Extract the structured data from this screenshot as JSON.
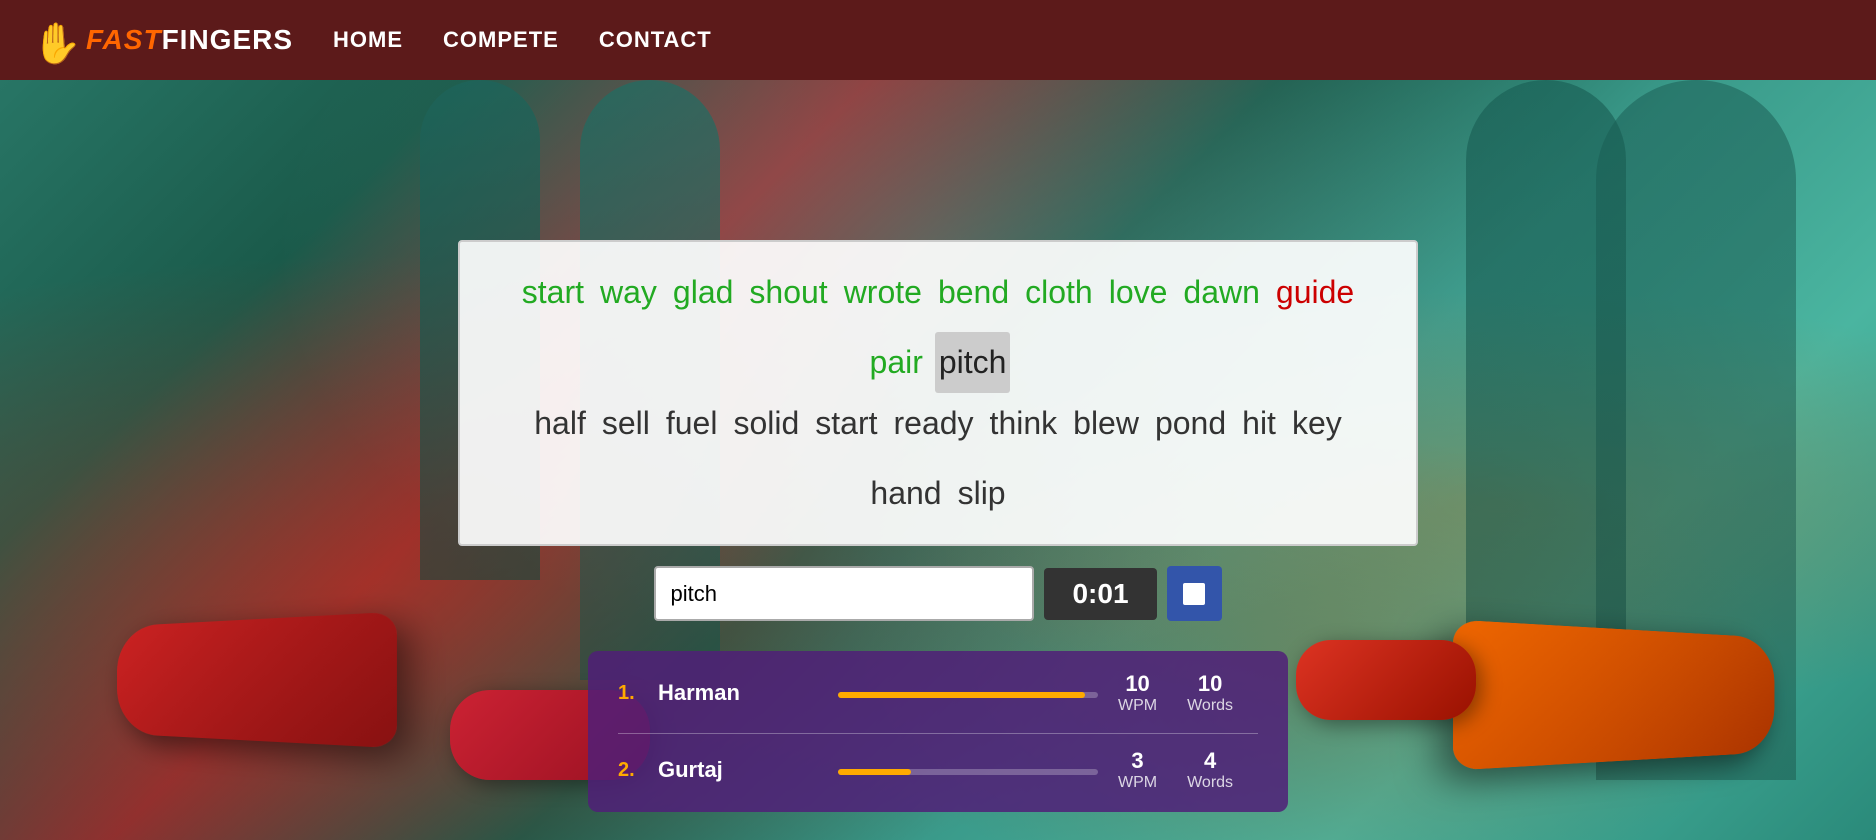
{
  "nav": {
    "logo_fast": "FAST",
    "logo_fingers": "FINGERS",
    "links": [
      {
        "label": "HOME",
        "id": "home"
      },
      {
        "label": "COMPETE",
        "id": "compete"
      },
      {
        "label": "CONTACT",
        "id": "contact"
      }
    ]
  },
  "words": {
    "row1": [
      {
        "text": "start",
        "state": "typed-correct"
      },
      {
        "text": "way",
        "state": "typed-correct"
      },
      {
        "text": "glad",
        "state": "typed-correct"
      },
      {
        "text": "shout",
        "state": "typed-correct"
      },
      {
        "text": "wrote",
        "state": "typed-correct"
      },
      {
        "text": "bend",
        "state": "typed-correct"
      },
      {
        "text": "cloth",
        "state": "typed-correct"
      },
      {
        "text": "love",
        "state": "typed-correct"
      },
      {
        "text": "dawn",
        "state": "typed-correct"
      },
      {
        "text": "guide",
        "state": "typed-error"
      },
      {
        "text": "pair",
        "state": "typed-correct"
      },
      {
        "text": "pitch",
        "state": "current"
      }
    ],
    "row2": [
      {
        "text": "half",
        "state": "upcoming"
      },
      {
        "text": "sell",
        "state": "upcoming"
      },
      {
        "text": "fuel",
        "state": "upcoming"
      },
      {
        "text": "solid",
        "state": "upcoming"
      },
      {
        "text": "start",
        "state": "upcoming"
      },
      {
        "text": "ready",
        "state": "upcoming"
      },
      {
        "text": "think",
        "state": "upcoming"
      },
      {
        "text": "blew",
        "state": "upcoming"
      },
      {
        "text": "pond",
        "state": "upcoming"
      },
      {
        "text": "hit",
        "state": "upcoming"
      },
      {
        "text": "key",
        "state": "upcoming"
      },
      {
        "text": "hand",
        "state": "upcoming"
      },
      {
        "text": "slip",
        "state": "upcoming"
      }
    ]
  },
  "input": {
    "value": "pitch",
    "placeholder": ""
  },
  "timer": {
    "display": "0:01"
  },
  "stop_button_label": "■",
  "leaderboard": {
    "players": [
      {
        "rank": "1.",
        "name": "Harman",
        "bar_percent": 95,
        "wpm": "10",
        "wpm_label": "WPM",
        "words": "10",
        "words_label": "Words"
      },
      {
        "rank": "2.",
        "name": "Gurtaj",
        "bar_percent": 28,
        "wpm": "3",
        "wpm_label": "WPM",
        "words": "4",
        "words_label": "Words"
      }
    ]
  }
}
